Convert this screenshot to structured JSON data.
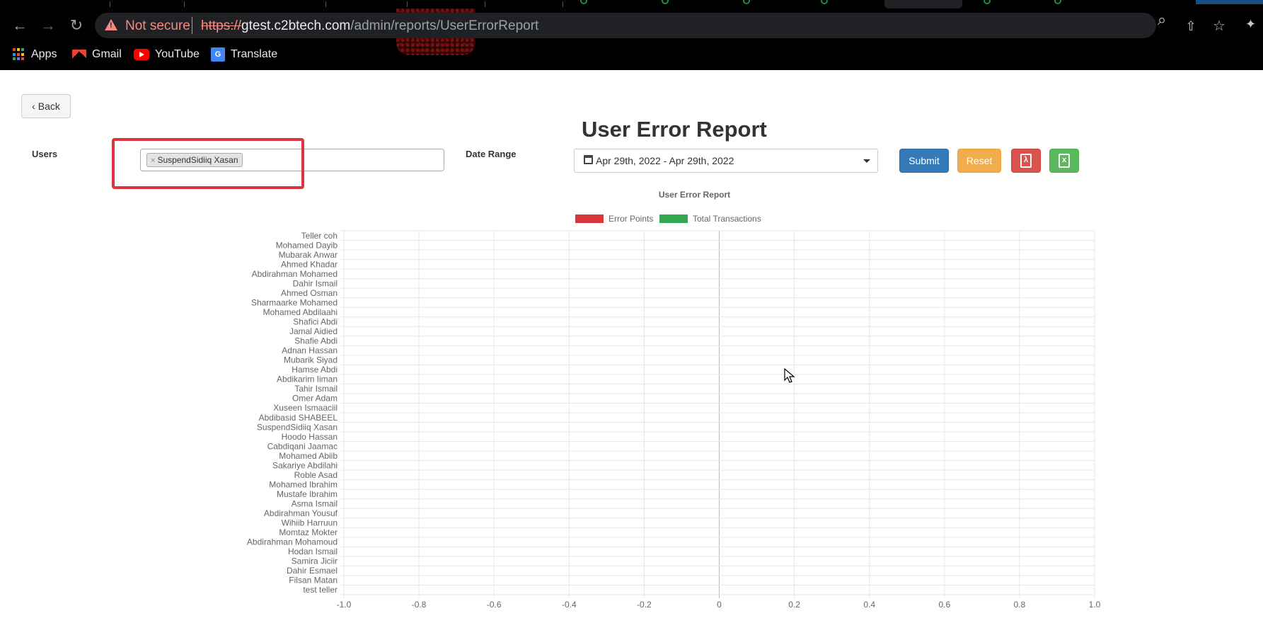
{
  "browser": {
    "security_label": "Not secure",
    "url_scheme": "https://",
    "url_host": "gtest.c2btech.com",
    "url_path": "/admin/reports/UserErrorReport",
    "bookmarks": [
      {
        "label": "Apps",
        "icon": "apps-grid-icon"
      },
      {
        "label": "Gmail",
        "icon": "gmail-icon"
      },
      {
        "label": "YouTube",
        "icon": "youtube-icon"
      },
      {
        "label": "Translate",
        "icon": "translate-icon"
      }
    ]
  },
  "page": {
    "back_label": "Back",
    "title": "User Error Report",
    "users_label": "Users",
    "selected_user": "SuspendSidiiq Xasan",
    "date_label": "Date Range",
    "date_range": "Apr 29th, 2022 - Apr 29th, 2022",
    "submit_label": "Submit",
    "reset_label": "Reset",
    "highlight_color": "#d9363e"
  },
  "chart_data": {
    "type": "bar",
    "orientation": "horizontal",
    "title": "User Error Report",
    "categories": [
      "Teller coh",
      "Mohamed Dayib",
      "Mubarak Anwar",
      "Ahmed Khadar",
      "Abdirahman Mohamed",
      "Dahir Ismail",
      "Ahmed Osman",
      "Sharmaarke Mohamed",
      "Mohamed Abdilaahi",
      "Shafici Abdi",
      "Jamal Aidied",
      "Shafie Abdi",
      "Adnan Hassan",
      "Mubarik Siyad",
      "Hamse Abdi",
      "Abdikarim Iiman",
      "Tahir Ismail",
      "Omer Adam",
      "Xuseen Ismaaciil",
      "Abdibasid SHABEEL",
      "SuspendSidiiq Xasan",
      "Hoodo Hassan",
      "Cabdiqani Jaamac",
      "Mohamed Abiib",
      "Sakariye Abdilahi",
      "Roble Asad",
      "Mohamed Ibrahim",
      "Mustafe Ibrahim",
      "Asma Ismail",
      "Abdirahman Yousuf",
      "Wihiib Harruun",
      "Momtaz Mokter",
      "Abdirahman Mohamoud",
      "Hodan Ismail",
      "Samira Jiciir",
      "Dahir Esmael",
      "Filsan Matan",
      "test teller"
    ],
    "series": [
      {
        "name": "Error Points",
        "color": "#d9363e",
        "values": []
      },
      {
        "name": "Total Transactions",
        "color": "#33a852",
        "values": []
      }
    ],
    "xlim": [
      -1.0,
      1.0
    ],
    "x_ticks": [
      "-1.0",
      "-0.8",
      "-0.6",
      "-0.4",
      "-0.2",
      "0",
      "0.2",
      "0.4",
      "0.6",
      "0.8",
      "1.0"
    ],
    "legend_position": "top",
    "grid": true
  }
}
